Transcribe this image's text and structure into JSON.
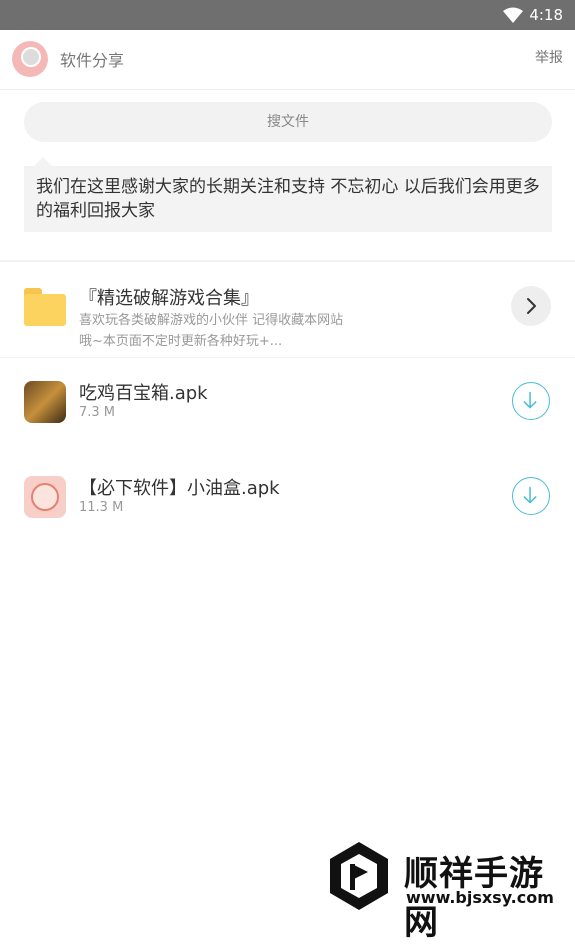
{
  "status_bar": {
    "time": "4:18",
    "wifi_icon": "wifi-icon"
  },
  "header": {
    "title": "软件分享",
    "report": "举报",
    "avatar_icon": "app-logo-avatar"
  },
  "search": {
    "label": "搜文件"
  },
  "notice": {
    "text": "我们在这里感谢大家的长期关注和支持 不忘初心 以后我们会用更多的福利回报大家"
  },
  "folder": {
    "name": "『精选破解游戏合集』",
    "desc_line1": "喜欢玩各类破解游戏的小伙伴 记得收藏本网站",
    "desc_line2": "哦~本页面不定时更新各种好玩+...",
    "icon": "folder-icon",
    "action_icon": "chevron-right-icon"
  },
  "files": [
    {
      "name": "吃鸡百宝箱.apk",
      "size": "7.3 M",
      "icon": "game-app-icon",
      "action_icon": "download-icon"
    },
    {
      "name": "【必下软件】小油盒.apk",
      "size": "11.3 M",
      "icon": "oil-box-app-icon",
      "action_icon": "download-icon"
    }
  ],
  "watermark": {
    "title": "顺祥手游网",
    "url": "www.bjsxsy.com"
  },
  "colors": {
    "accent": "#48bcd8",
    "status_bar": "#6f6f6f",
    "folder": "#fbd35e"
  }
}
